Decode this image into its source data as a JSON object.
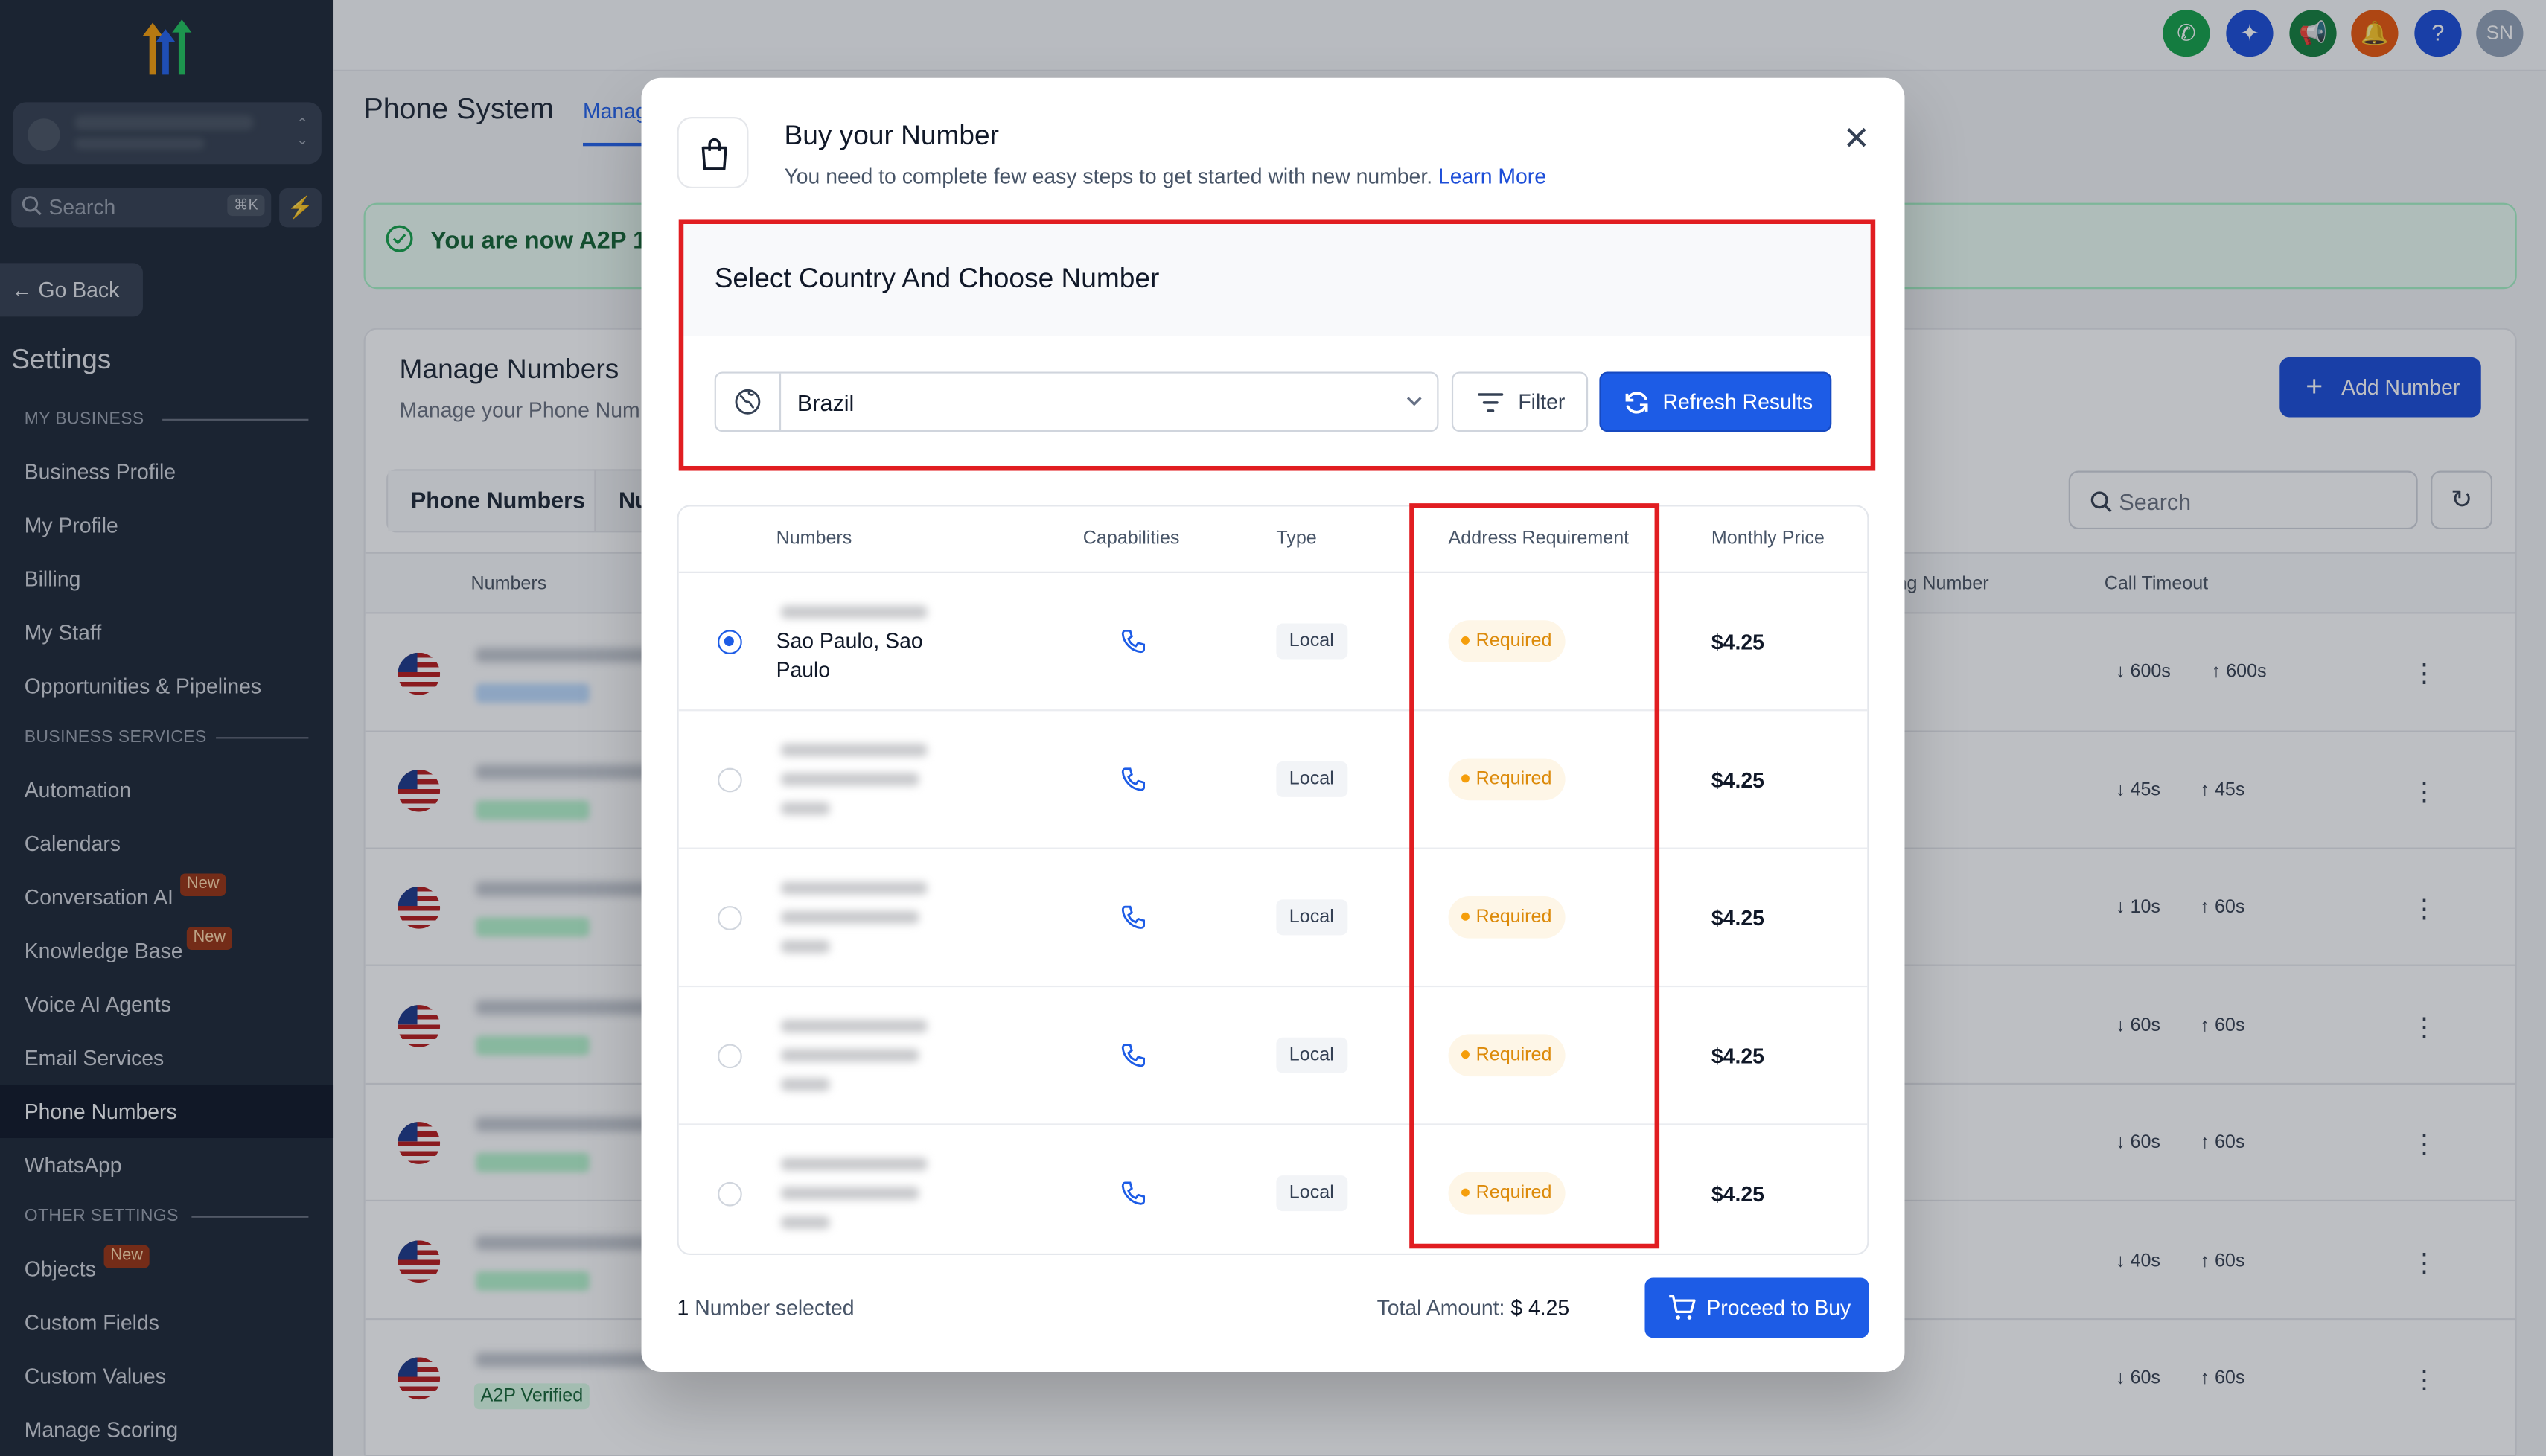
{
  "sidebar": {
    "search_placeholder": "Search",
    "search_shortcut": "⌘K",
    "go_back": "Go Back",
    "settings_title": "Settings",
    "sections": {
      "my_business": "MY BUSINESS",
      "business_services": "BUSINESS SERVICES",
      "other_settings": "OTHER SETTINGS"
    },
    "items": {
      "business_profile": "Business Profile",
      "my_profile": "My Profile",
      "billing": "Billing",
      "my_staff": "My Staff",
      "opportunities": "Opportunities & Pipelines",
      "automation": "Automation",
      "calendars": "Calendars",
      "conversation_ai": "Conversation AI",
      "knowledge_base": "Knowledge Base",
      "voice_ai": "Voice AI Agents",
      "email_services": "Email Services",
      "phone_numbers": "Phone Numbers",
      "whatsapp": "WhatsApp",
      "objects": "Objects",
      "custom_fields": "Custom Fields",
      "custom_values": "Custom Values",
      "manage_scoring": "Manage Scoring"
    },
    "new_badge": "New"
  },
  "header": {
    "avatar_initials": "SN",
    "help_icon": "?"
  },
  "background": {
    "page_title": "Phone System",
    "tab_label": "Manag",
    "banner_text": "You are now A2P 1",
    "manage_title": "Manage Numbers",
    "manage_subtitle": "Manage your Phone Num",
    "add_number": "Add Number",
    "tabs": [
      "Phone Numbers",
      "Nu"
    ],
    "search_placeholder": "Search",
    "columns": {
      "numbers": "Numbers",
      "forwarding": "ng Number",
      "call_timeout": "Call Timeout"
    },
    "rows": [
      {
        "in": "600s",
        "out": "600s"
      },
      {
        "in": "45s",
        "out": "45s"
      },
      {
        "in": "10s",
        "out": "60s"
      },
      {
        "in": "60s",
        "out": "60s"
      },
      {
        "in": "60s",
        "out": "60s"
      },
      {
        "in": "40s",
        "out": "60s"
      },
      {
        "in": "60s",
        "out": "60s"
      }
    ],
    "a2p_badge": "A2P Verified"
  },
  "modal": {
    "title": "Buy your Number",
    "subtitle": "You need to complete few easy steps to get started with new number.",
    "learn_more": "Learn More",
    "section_title": "Select Country And Choose Number",
    "country": "Brazil",
    "filter_label": "Filter",
    "refresh_label": "Refresh Results",
    "columns": {
      "numbers": "Numbers",
      "capabilities": "Capabilities",
      "type": "Type",
      "address": "Address Requirement",
      "price": "Monthly Price"
    },
    "rows": [
      {
        "city": "Sao Paulo, Sao Paulo",
        "type": "Local",
        "address": "Required",
        "price": "$4.25",
        "selected": true
      },
      {
        "city": "",
        "type": "Local",
        "address": "Required",
        "price": "$4.25",
        "selected": false
      },
      {
        "city": "",
        "type": "Local",
        "address": "Required",
        "price": "$4.25",
        "selected": false
      },
      {
        "city": "",
        "type": "Local",
        "address": "Required",
        "price": "$4.25",
        "selected": false
      },
      {
        "city": "",
        "type": "Local",
        "address": "Required",
        "price": "$4.25",
        "selected": false
      }
    ],
    "selected_count": "1",
    "selected_label": "Number selected",
    "total_label": "Total Amount:",
    "total_value": "$ 4.25",
    "buy_label": "Proceed to Buy"
  },
  "colors": {
    "primary": "#1d5ce6",
    "highlight_box": "#e11d21",
    "required": "#dc8a0a",
    "sidebar_bg": "#1f2937"
  }
}
